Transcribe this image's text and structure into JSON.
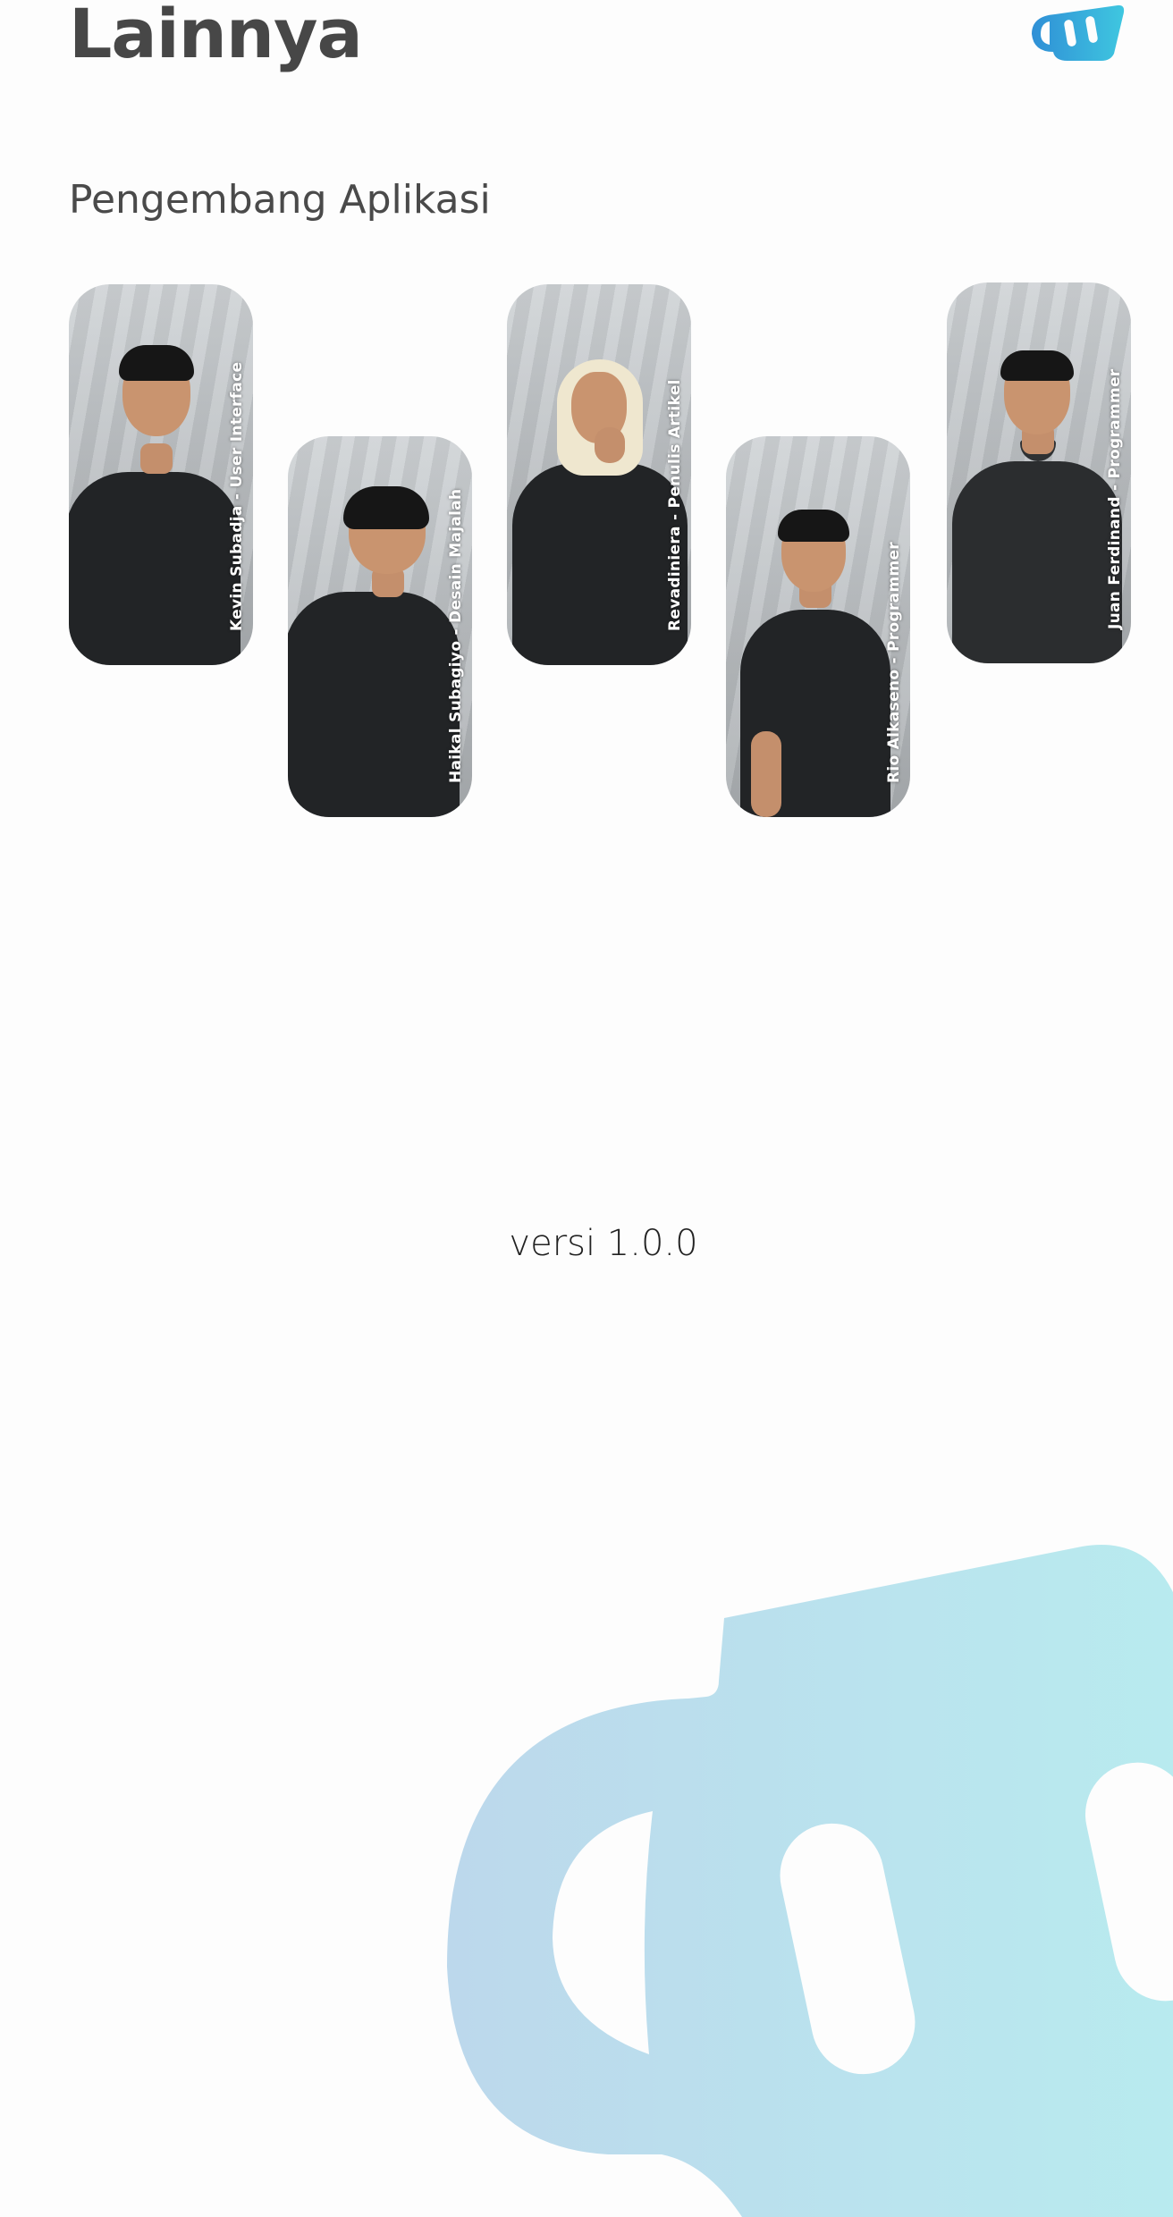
{
  "header": {
    "title": "Lainnya",
    "logo_icon": "mug-logo-icon"
  },
  "developers_section": {
    "title": "Pengembang Aplikasi",
    "developers": [
      {
        "label": "Kevin Subadja - User Interface"
      },
      {
        "label": "Haikal Subagiyo - Desain Majalah"
      },
      {
        "label": "Revadiniera - Penulis Artikel"
      },
      {
        "label": "Rio Alkaseno - Programmer"
      },
      {
        "label": "Juan Ferdinand - Programmer"
      }
    ]
  },
  "version": "versi 1.0.0",
  "colors": {
    "title": "#474747",
    "logo_blue": "#2f8fd6",
    "logo_cyan": "#3fc7e0",
    "watermark_start": "#bcd8ec",
    "watermark_end": "#b8ecef"
  }
}
